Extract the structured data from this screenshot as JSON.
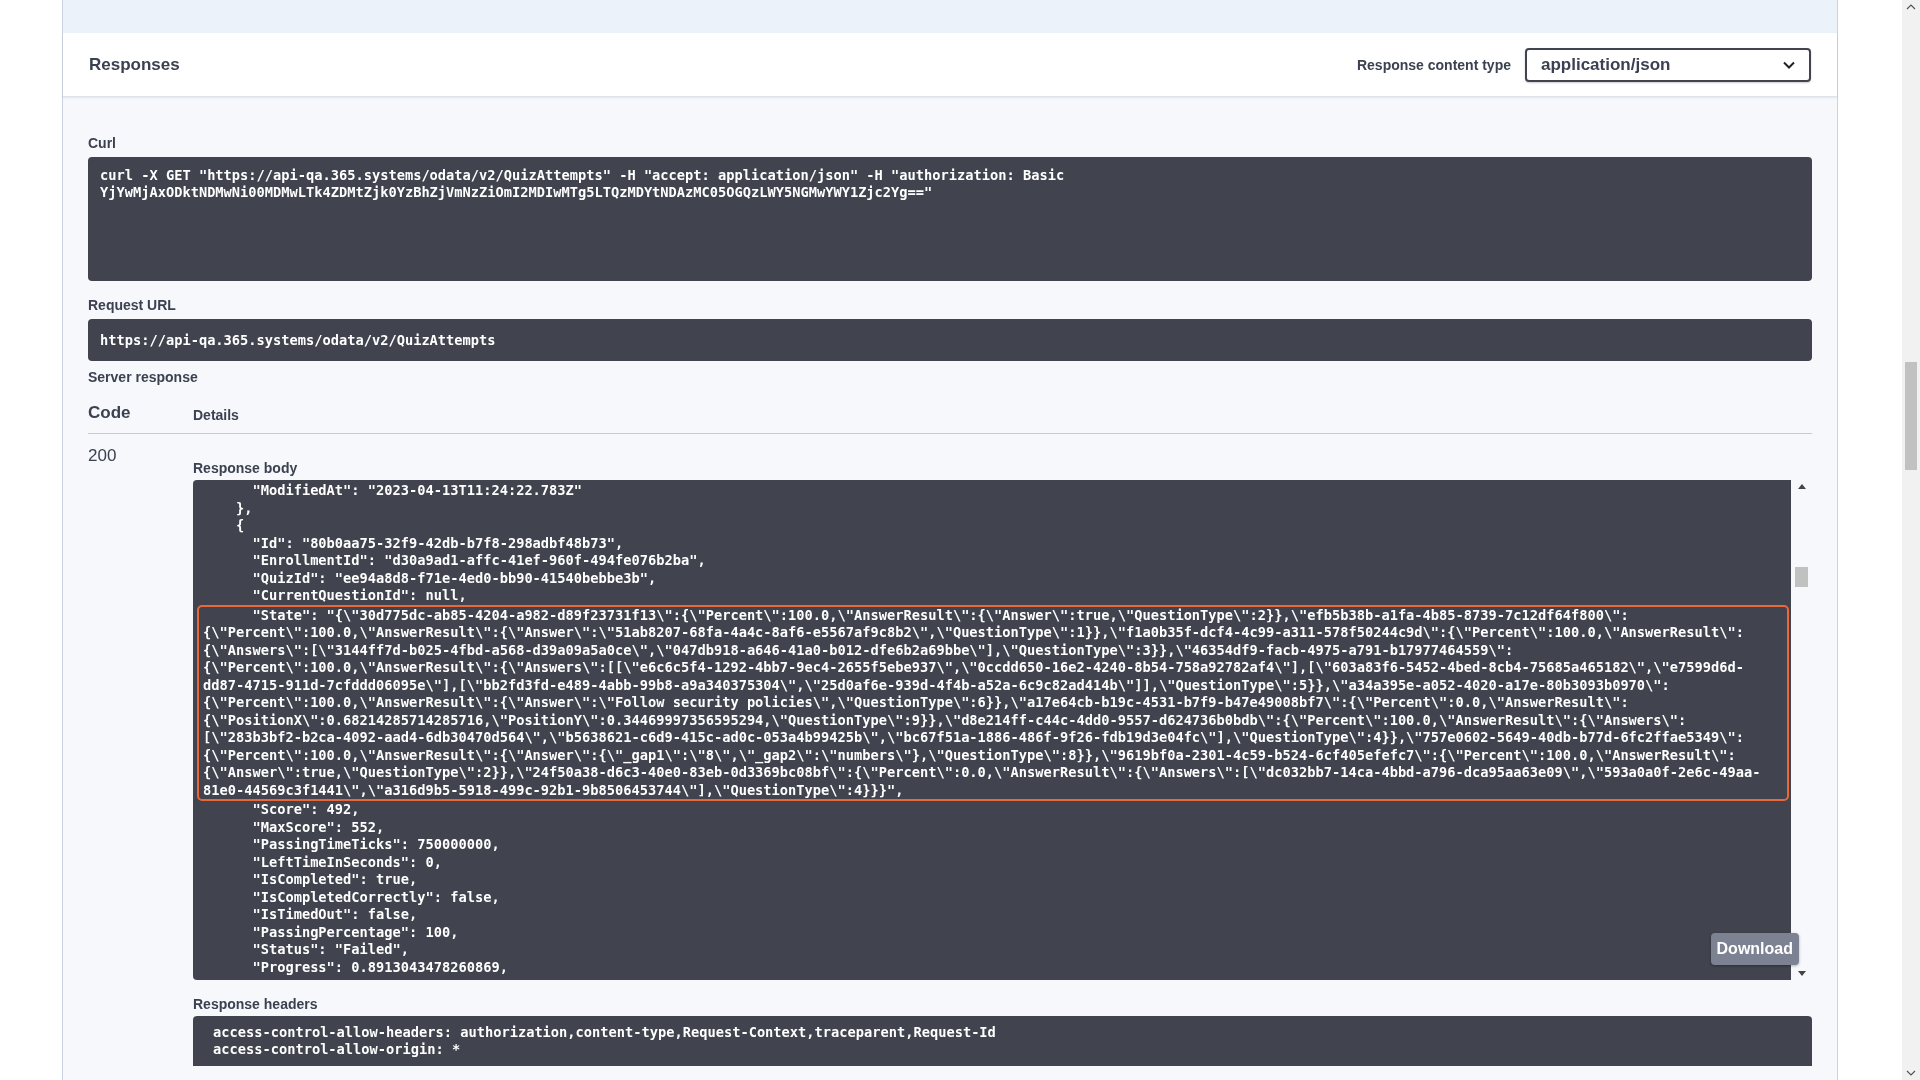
{
  "header": {
    "title": "Responses",
    "content_type_label": "Response content type",
    "content_type": "application/json"
  },
  "curl": {
    "label": "Curl",
    "lines": [
      "curl -X GET \"https://api-qa.365.systems/odata/v2/QuizAttempts\" -H \"accept: application/json\" -H \"authorization: Basic",
      "YjYwMjAxODktNDMwNi00MDMwLTk4ZDMtZjk0YzBhZjVmNzZiOmI2MDIwMTg5LTQzMDYtNDAzMC05OGQzLWY5NGMwYWY1Zjc2Yg==\""
    ]
  },
  "request_url": {
    "label": "Request URL",
    "value": "https://api-qa.365.systems/odata/v2/QuizAttempts"
  },
  "server_response": {
    "label": "Server response",
    "columns": [
      "Code",
      "Details"
    ],
    "code": "200",
    "body_label": "Response body",
    "lines_before": [
      "      \"ModifiedAt\": \"2023-04-13T11:24:22.783Z\"",
      "    },",
      "    {",
      "      \"Id\": \"80b0aa75-32f9-42db-b7f8-298adbf48b73\",",
      "      \"EnrollmentId\": \"d30a9ad1-affc-41ef-960f-494fe076b2ba\",",
      "      \"QuizId\": \"ee94a8d8-f71e-4ed0-bb90-41540bebbe3b\",",
      "      \"CurrentQuestionId\": null,"
    ],
    "highlighted_lines": [
      "      \"State\": \"{\\\"30d775dc-ab85-4204-a982-d89f23731f13\\\":{\\\"Percent\\\":100.0,\\\"AnswerResult\\\":{\\\"Answer\\\":true,\\\"QuestionType\\\":2}},\\\"efb5b38b-a1fa-4b85-8739-7c12df64f800\\\":",
      "{\\\"Percent\\\":100.0,\\\"AnswerResult\\\":{\\\"Answer\\\":\\\"51ab8207-68fa-4a4c-8af6-e5567af9c8b2\\\",\\\"QuestionType\\\":1}},\\\"f1a0b35f-dcf4-4c99-a311-578f50244c9d\\\":{\\\"Percent\\\":100.0,\\\"AnswerResult\\\":",
      "{\\\"Answers\\\":[\\\"3144ff7d-b025-4fbd-a568-d39a09a5a0ce\\\",\\\"047db918-a646-41a0-b012-dfe6b2a69bbe\\\"],\\\"QuestionType\\\":3}},\\\"46354df9-facb-4975-a791-b17977464559\\\":",
      "{\\\"Percent\\\":100.0,\\\"AnswerResult\\\":{\\\"Answers\\\":[[\\\"e6c6c5f4-1292-4bb7-9ec4-2655f5ebe937\\\",\\\"0ccdd650-16e2-4240-8b54-758a92782af4\\\"],[\\\"603a83f6-5452-4bed-8cb4-75685a465182\\\",\\\"e7599d6d-",
      "dd87-4715-911d-7cfddd06095e\\\"],[\\\"bb2fd3fd-e489-4abb-99b8-a9a340375304\\\",\\\"25d0af6e-939d-4f4b-a52a-6c9c82ad414b\\\"]],\\\"QuestionType\\\":5}},\\\"a34a395e-a052-4020-a17e-80b3093b0970\\\":",
      "{\\\"Percent\\\":100.0,\\\"AnswerResult\\\":{\\\"Answer\\\":\\\"Follow security policies\\\",\\\"QuestionType\\\":6}},\\\"a17e64cb-b19c-4531-b7f9-b47e49008bf7\\\":{\\\"Percent\\\":0.0,\\\"AnswerResult\\\":",
      "{\\\"PositionX\\\":0.68214285714285716,\\\"PositionY\\\":0.34469997356595294,\\\"QuestionType\\\":9}},\\\"d8e214ff-c44c-4dd0-9557-d624736b0bdb\\\":{\\\"Percent\\\":100.0,\\\"AnswerResult\\\":{\\\"Answers\\\":",
      "[\\\"283b3bf2-b2ca-4092-aad4-6db30470d564\\\",\\\"b5638621-c6d9-415c-ad0c-053a4b99425b\\\",\\\"bc67f51a-1886-486f-9f26-fdb19d3e04fc\\\"],\\\"QuestionType\\\":4}},\\\"757e0602-5649-40db-b77d-6fc2ffae5349\\\":",
      "{\\\"Percent\\\":100.0,\\\"AnswerResult\\\":{\\\"Answer\\\":{\\\"_gap1\\\":\\\"8\\\",\\\"_gap2\\\":\\\"numbers\\\"},\\\"QuestionType\\\":8}},\\\"9619bf0a-2301-4c59-b524-6cf405efefc7\\\":{\\\"Percent\\\":100.0,\\\"AnswerResult\\\":",
      "{\\\"Answer\\\":true,\\\"QuestionType\\\":2}},\\\"24f50a38-d6c3-40e0-83eb-0d3369bc08bf\\\":{\\\"Percent\\\":0.0,\\\"AnswerResult\\\":{\\\"Answers\\\":[\\\"dc032bb7-14ca-4bbd-a796-dca95aa63e09\\\",\\\"593a0a0f-2e6c-49aa-",
      "81e0-44569c3f1441\\\",\\\"a316d9b5-5918-499c-92b1-9b8506453744\\\"],\\\"QuestionType\\\":4}}}\","
    ],
    "lines_after": [
      "      \"Score\": 492,",
      "      \"MaxScore\": 552,",
      "      \"PassingTimeTicks\": 750000000,",
      "      \"LeftTimeInSeconds\": 0,",
      "      \"IsCompleted\": true,",
      "      \"IsCompletedCorrectly\": false,",
      "      \"IsTimedOut\": false,",
      "      \"PassingPercentage\": 100,",
      "      \"Status\": \"Failed\",",
      "      \"Progress\": 0.8913043478260869,"
    ],
    "download": "Download",
    "headers_label": "Response headers",
    "header_lines": [
      "access-control-allow-headers: authorization,content-type,Request-Context,traceparent,Request-Id",
      "access-control-allow-origin: *"
    ]
  }
}
